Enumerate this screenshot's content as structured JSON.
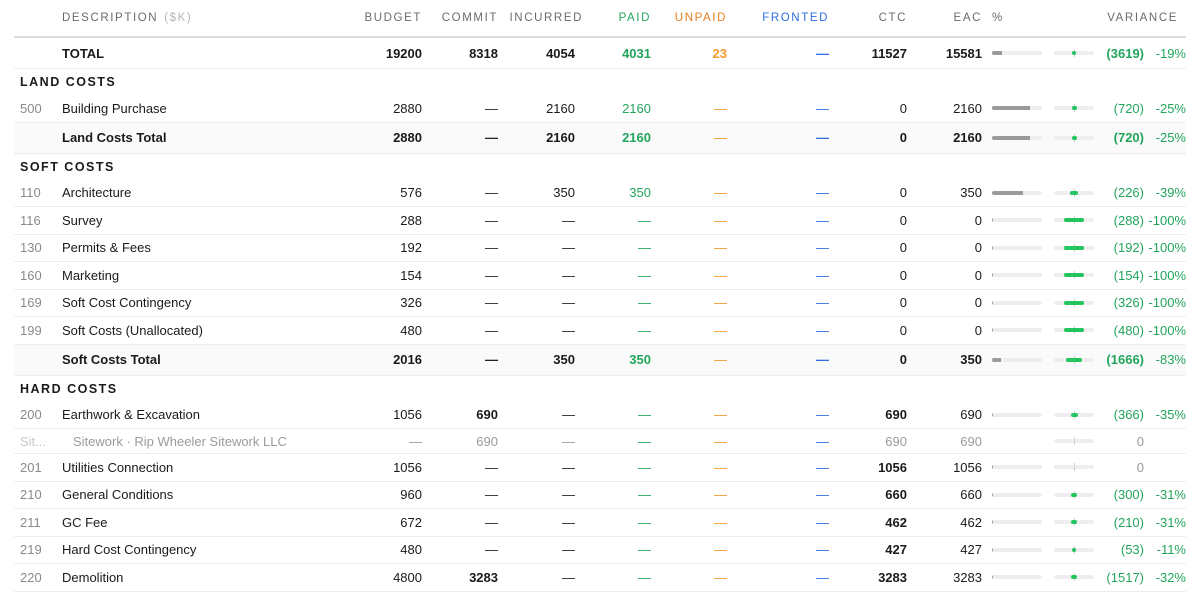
{
  "header": {
    "description": "DESCRIPTION",
    "unit": "($K)",
    "budget": "BUDGET",
    "commit": "COMMIT",
    "incurred": "INCURRED",
    "paid": "PAID",
    "unpaid": "UNPAID",
    "fronted": "FRONTED",
    "ctc": "CTC",
    "eac": "EAC",
    "pct": "%",
    "variance": "VARIANCE"
  },
  "colors": {
    "paid": "#22a55b",
    "unpaid": "#f39a2c",
    "fronted": "#2f6fe0",
    "variance_bar": "#22c55e"
  },
  "rows": [
    {
      "kind": "total",
      "desc": "TOTAL",
      "budget": "19200",
      "commit": "8318",
      "incurred": "4054",
      "paid": "4031",
      "unpaid": "23",
      "fronted": "—",
      "ctc": "11527",
      "eac": "15581",
      "eac_frac": 0.2,
      "var_frac": -0.19,
      "variance": "(3619)",
      "variance_pct": "-19%"
    },
    {
      "kind": "section",
      "desc": "LAND COSTS"
    },
    {
      "kind": "item",
      "code": "500",
      "desc": "Building Purchase",
      "budget": "2880",
      "commit": "—",
      "incurred": "2160",
      "paid": "2160",
      "unpaid": "—",
      "fronted": "—",
      "ctc": "0",
      "eac": "2160",
      "eac_frac": 0.75,
      "var_frac": -0.25,
      "variance": "(720)",
      "variance_pct": "-25%"
    },
    {
      "kind": "subtotal",
      "desc": "Land Costs Total",
      "budget": "2880",
      "commit": "—",
      "incurred": "2160",
      "paid": "2160",
      "unpaid": "—",
      "fronted": "—",
      "ctc": "0",
      "eac": "2160",
      "eac_frac": 0.75,
      "var_frac": -0.25,
      "variance": "(720)",
      "variance_pct": "-25%"
    },
    {
      "kind": "section",
      "desc": "SOFT COSTS"
    },
    {
      "kind": "item",
      "code": "110",
      "desc": "Architecture",
      "budget": "576",
      "commit": "—",
      "incurred": "350",
      "paid": "350",
      "unpaid": "—",
      "fronted": "—",
      "ctc": "0",
      "eac": "350",
      "eac_frac": 0.61,
      "var_frac": -0.39,
      "variance": "(226)",
      "variance_pct": "-39%"
    },
    {
      "kind": "item",
      "code": "116",
      "desc": "Survey",
      "budget": "288",
      "commit": "—",
      "incurred": "—",
      "paid": "—",
      "unpaid": "—",
      "fronted": "—",
      "ctc": "0",
      "eac": "0",
      "eac_frac": 0,
      "var_frac": -1,
      "variance": "(288)",
      "variance_pct": "-100%"
    },
    {
      "kind": "item",
      "code": "130",
      "desc": "Permits & Fees",
      "budget": "192",
      "commit": "—",
      "incurred": "—",
      "paid": "—",
      "unpaid": "—",
      "fronted": "—",
      "ctc": "0",
      "eac": "0",
      "eac_frac": 0,
      "var_frac": -1,
      "variance": "(192)",
      "variance_pct": "-100%"
    },
    {
      "kind": "item",
      "code": "160",
      "desc": "Marketing",
      "budget": "154",
      "commit": "—",
      "incurred": "—",
      "paid": "—",
      "unpaid": "—",
      "fronted": "—",
      "ctc": "0",
      "eac": "0",
      "eac_frac": 0,
      "var_frac": -1,
      "variance": "(154)",
      "variance_pct": "-100%"
    },
    {
      "kind": "item",
      "code": "169",
      "desc": "Soft Cost Contingency",
      "budget": "326",
      "commit": "—",
      "incurred": "—",
      "paid": "—",
      "unpaid": "—",
      "fronted": "—",
      "ctc": "0",
      "eac": "0",
      "eac_frac": 0,
      "var_frac": -1,
      "variance": "(326)",
      "variance_pct": "-100%"
    },
    {
      "kind": "item",
      "code": "199",
      "desc": "Soft Costs (Unallocated)",
      "budget": "480",
      "commit": "—",
      "incurred": "—",
      "paid": "—",
      "unpaid": "—",
      "fronted": "—",
      "ctc": "0",
      "eac": "0",
      "eac_frac": 0,
      "var_frac": -1,
      "variance": "(480)",
      "variance_pct": "-100%"
    },
    {
      "kind": "subtotal",
      "desc": "Soft Costs Total",
      "budget": "2016",
      "commit": "—",
      "incurred": "350",
      "paid": "350",
      "unpaid": "—",
      "fronted": "—",
      "ctc": "0",
      "eac": "350",
      "eac_frac": 0.17,
      "var_frac": -0.83,
      "variance": "(1666)",
      "variance_pct": "-83%"
    },
    {
      "kind": "section",
      "desc": "HARD COSTS"
    },
    {
      "kind": "item",
      "code": "200",
      "desc": "Earthwork & Excavation",
      "budget": "1056",
      "commit": "690",
      "incurred": "—",
      "paid": "—",
      "unpaid": "—",
      "fronted": "—",
      "ctc": "690",
      "eac": "690",
      "eac_frac": 0,
      "var_frac": -0.35,
      "variance": "(366)",
      "variance_pct": "-35%"
    },
    {
      "kind": "vendor",
      "code": "Sit...",
      "desc": "Sitework · Rip Wheeler Sitework LLC",
      "budget": "—",
      "commit": "690",
      "incurred": "—",
      "paid": "—",
      "unpaid": "—",
      "fronted": "—",
      "ctc": "690",
      "eac": "690",
      "var_frac": 0,
      "variance": "0",
      "variance_pct": ""
    },
    {
      "kind": "item",
      "code": "201",
      "desc": "Utilities Connection",
      "budget": "1056",
      "commit": "—",
      "incurred": "—",
      "paid": "—",
      "unpaid": "—",
      "fronted": "—",
      "ctc": "1056",
      "eac": "1056",
      "eac_frac": 0,
      "var_frac": 0,
      "variance": "0",
      "variance_pct": ""
    },
    {
      "kind": "item",
      "code": "210",
      "desc": "General Conditions",
      "budget": "960",
      "commit": "—",
      "incurred": "—",
      "paid": "—",
      "unpaid": "—",
      "fronted": "—",
      "ctc": "660",
      "eac": "660",
      "eac_frac": 0,
      "var_frac": -0.31,
      "variance": "(300)",
      "variance_pct": "-31%"
    },
    {
      "kind": "item",
      "code": "211",
      "desc": "GC Fee",
      "budget": "672",
      "commit": "—",
      "incurred": "—",
      "paid": "—",
      "unpaid": "—",
      "fronted": "—",
      "ctc": "462",
      "eac": "462",
      "eac_frac": 0,
      "var_frac": -0.31,
      "variance": "(210)",
      "variance_pct": "-31%"
    },
    {
      "kind": "item",
      "code": "219",
      "desc": "Hard Cost Contingency",
      "budget": "480",
      "commit": "—",
      "incurred": "—",
      "paid": "—",
      "unpaid": "—",
      "fronted": "—",
      "ctc": "427",
      "eac": "427",
      "eac_frac": 0,
      "var_frac": -0.11,
      "variance": "(53)",
      "variance_pct": "-11%"
    },
    {
      "kind": "item",
      "code": "220",
      "desc": "Demolition",
      "budget": "4800",
      "commit": "3283",
      "incurred": "—",
      "paid": "—",
      "unpaid": "—",
      "fronted": "—",
      "ctc": "3283",
      "eac": "3283",
      "eac_frac": 0,
      "var_frac": -0.32,
      "variance": "(1517)",
      "variance_pct": "-32%"
    }
  ]
}
